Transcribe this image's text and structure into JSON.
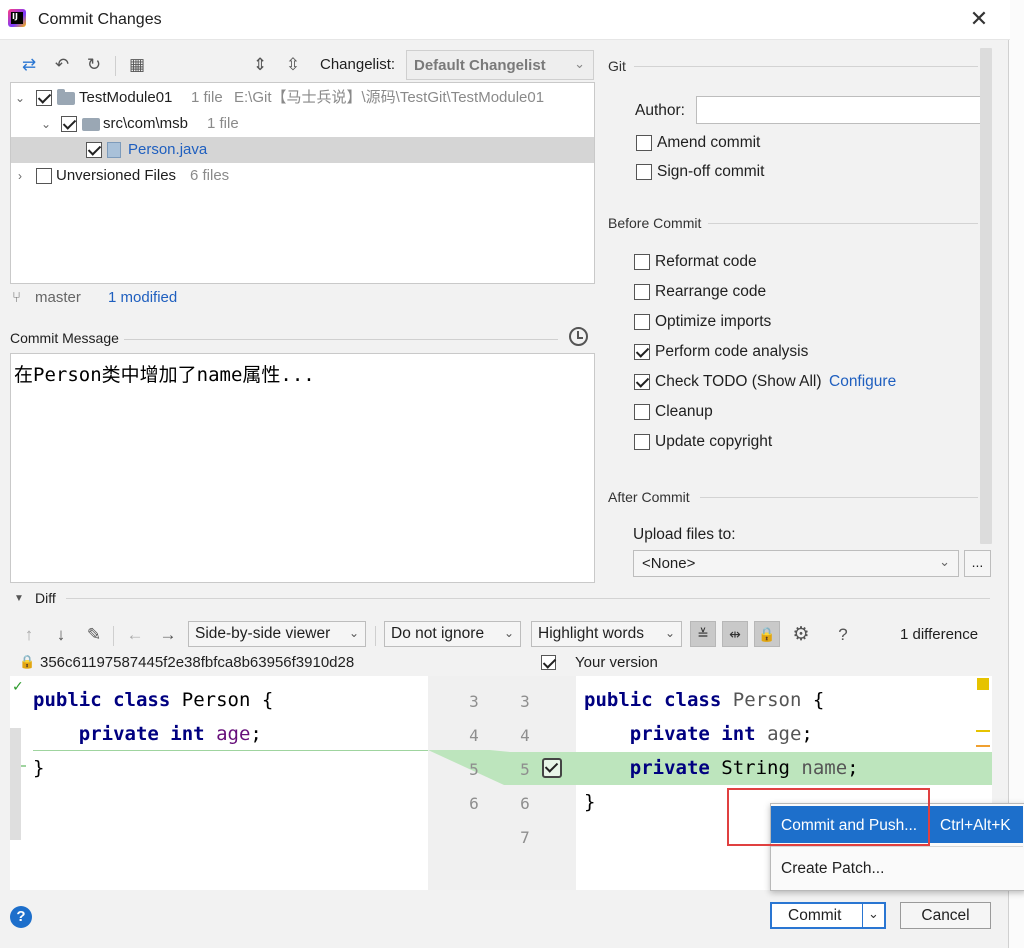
{
  "window": {
    "title": "Commit Changes"
  },
  "toolbar": {
    "changelist_label": "Changelist:",
    "changelist_value": "Default Changelist"
  },
  "tree": {
    "module_name": "TestModule01",
    "module_count": "1 file",
    "module_path": "E:\\Git【马士兵说】\\源码\\TestGit\\TestModule01",
    "package_name": "src\\com\\msb",
    "package_count": "1 file",
    "file_name": "Person.java",
    "unversioned_label": "Unversioned Files",
    "unversioned_count": "6 files"
  },
  "status": {
    "branch": "master",
    "modified": "1 modified"
  },
  "commit_message": {
    "label": "Commit Message",
    "text": "在Person类中增加了name属性..."
  },
  "git": {
    "section": "Git",
    "author_label": "Author:",
    "author_value": "",
    "amend_commit": "Amend commit",
    "signoff_commit": "Sign-off commit"
  },
  "before_commit": {
    "section": "Before Commit",
    "reformat": "Reformat code",
    "rearrange": "Rearrange code",
    "optimize": "Optimize imports",
    "analysis": "Perform code analysis",
    "todo": "Check TODO (Show All)",
    "configure": "Configure",
    "cleanup": "Cleanup",
    "copyright": "Update copyright"
  },
  "after_commit": {
    "section": "After Commit",
    "upload_label": "Upload files to:",
    "upload_value": "<None>",
    "browse": "..."
  },
  "diff": {
    "section": "Diff",
    "viewer": "Side-by-side viewer",
    "ignore": "Do not ignore",
    "highlight": "Highlight words",
    "help": "?",
    "difference_count": "1 difference",
    "left_revision": "356c61197587445f2e38fbfca8b63956f3910d28",
    "right_revision": "Your version",
    "left_lines": [
      "3",
      "4",
      "5",
      "6"
    ],
    "right_lines": [
      "3",
      "4",
      "5",
      "6",
      "7"
    ]
  },
  "code": {
    "kw_public": "public",
    "kw_class": "class",
    "class_name": "Person",
    "open_brace": "{",
    "close_brace": "}",
    "kw_private": "private",
    "kw_int": "int",
    "field_age": "age",
    "semicolon": ";",
    "type_string": "String",
    "field_name": "name"
  },
  "popup": {
    "commit_and_push": "Commit and Push...",
    "shortcut": "Ctrl+Alt+K",
    "create_patch": "Create Patch..."
  },
  "footer": {
    "help": "?",
    "commit": "Commit",
    "cancel": "Cancel"
  }
}
